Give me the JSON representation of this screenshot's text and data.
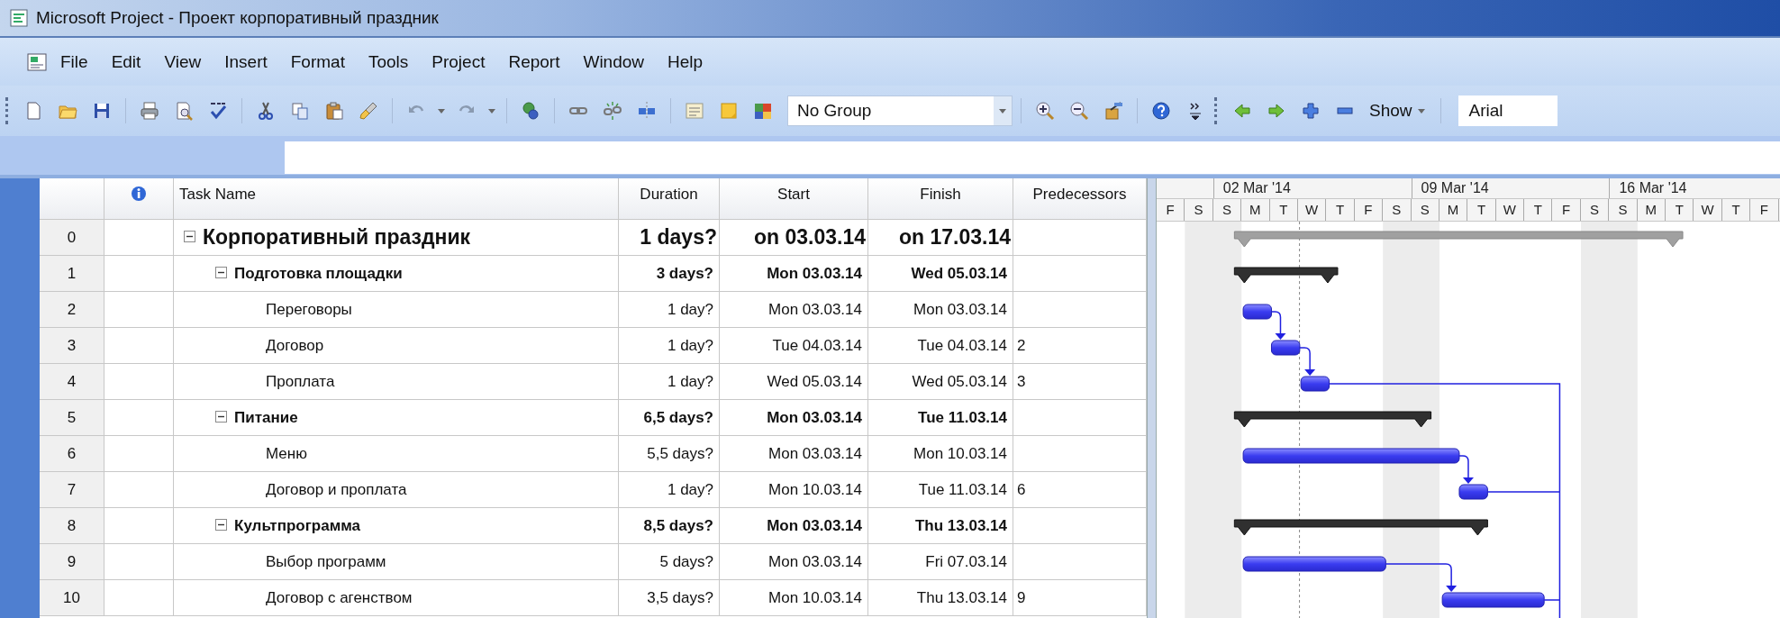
{
  "window": {
    "title": "Microsoft Project - Проект корпоративный праздник"
  },
  "menu": [
    "File",
    "Edit",
    "View",
    "Insert",
    "Format",
    "Tools",
    "Project",
    "Report",
    "Window",
    "Help"
  ],
  "toolbar": {
    "group_select": {
      "value": "No Group"
    },
    "show_button": "Show",
    "font_select": {
      "value": "Arial"
    }
  },
  "table": {
    "columns": [
      "Task Name",
      "Duration",
      "Start",
      "Finish",
      "Predecessors"
    ],
    "tasks": [
      {
        "id": "0",
        "name": "Корпоративный праздник",
        "duration": "1 days?",
        "start": "on 03.03.14",
        "finish": "on 17.03.14",
        "expanded": true,
        "children": [
          {
            "id": "1",
            "name": "Подготовка площадки",
            "duration": "3 days?",
            "start": "Mon 03.03.14",
            "finish": "Wed 05.03.14",
            "expanded": true,
            "children": [
              {
                "id": "2",
                "name": "Переговоры",
                "duration": "1 day?",
                "start": "Mon 03.03.14",
                "finish": "Mon 03.03.14"
              },
              {
                "id": "3",
                "name": "Договор",
                "duration": "1 day?",
                "start": "Tue 04.03.14",
                "finish": "Tue 04.03.14",
                "predecessors": "2"
              },
              {
                "id": "4",
                "name": "Проплата",
                "duration": "1 day?",
                "start": "Wed 05.03.14",
                "finish": "Wed 05.03.14",
                "predecessors": "3"
              }
            ]
          },
          {
            "id": "5",
            "name": "Питание",
            "duration": "6,5 days?",
            "start": "Mon 03.03.14",
            "finish": "Tue 11.03.14",
            "expanded": true,
            "children": [
              {
                "id": "6",
                "name": "Меню",
                "duration": "5,5 days?",
                "start": "Mon 03.03.14",
                "finish": "Mon 10.03.14"
              },
              {
                "id": "7",
                "name": "Договор и проплата",
                "duration": "1 day?",
                "start": "Mon 10.03.14",
                "finish": "Tue 11.03.14",
                "predecessors": "6"
              }
            ]
          },
          {
            "id": "8",
            "name": "Культпрограмма",
            "duration": "8,5 days?",
            "start": "Mon 03.03.14",
            "finish": "Thu 13.03.14",
            "expanded": true,
            "children": [
              {
                "id": "9",
                "name": "Выбор программ",
                "duration": "5 days?",
                "start": "Mon 03.03.14",
                "finish": "Fri 07.03.14"
              },
              {
                "id": "10",
                "name": "Договор с агенством",
                "duration": "3,5 days?",
                "start": "Mon 10.03.14",
                "finish": "Thu 13.03.14",
                "predecessors": "9"
              }
            ]
          }
        ]
      }
    ]
  },
  "gantt": {
    "weeks": [
      "02 Mar '14",
      "09 Mar '14",
      "16 Mar '14"
    ],
    "days": [
      "F",
      "S",
      "S",
      "M",
      "T",
      "W",
      "T",
      "F",
      "S",
      "S",
      "M",
      "T",
      "W",
      "T",
      "F",
      "S",
      "S",
      "M",
      "T",
      "W",
      "T",
      "F"
    ]
  }
}
